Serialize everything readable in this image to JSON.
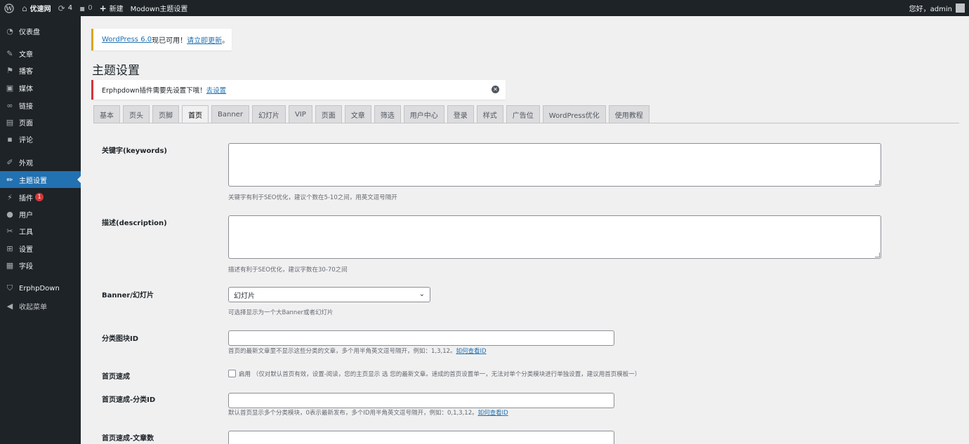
{
  "adminbar": {
    "site_name": "优速网",
    "updates_count": "4",
    "comments_count": "0",
    "new_label": "新建",
    "theme_settings_label": "Modown主题设置",
    "greeting": "您好，admin"
  },
  "sidebar": {
    "items": [
      {
        "label": "仪表盘",
        "icon": "dashboard-icon"
      },
      {
        "label": "文章",
        "icon": "pin-icon"
      },
      {
        "label": "播客",
        "icon": "flag-icon"
      },
      {
        "label": "媒体",
        "icon": "media-icon"
      },
      {
        "label": "链接",
        "icon": "link-icon"
      },
      {
        "label": "页面",
        "icon": "page-icon"
      },
      {
        "label": "评论",
        "icon": "comment-icon"
      },
      {
        "label": "外观",
        "icon": "brush-icon"
      },
      {
        "label": "主题设置",
        "icon": "pen-icon"
      },
      {
        "label": "插件",
        "icon": "plugin-icon",
        "badge": "1"
      },
      {
        "label": "用户",
        "icon": "user-icon"
      },
      {
        "label": "工具",
        "icon": "wrench-icon"
      },
      {
        "label": "设置",
        "icon": "settings-icon"
      },
      {
        "label": "字段",
        "icon": "fields-icon"
      },
      {
        "label": "ErphpDown",
        "icon": "shield-icon"
      },
      {
        "label": "收起菜单",
        "icon": "collapse-icon"
      }
    ]
  },
  "notices": {
    "update_link": "WordPress 6.0",
    "update_text": "现已可用！",
    "update_now": "请立即更新",
    "update_period": "。",
    "erphp_text": "Erphpdown插件需要先设置下哦！",
    "erphp_link": "去设置"
  },
  "page": {
    "title": "主题设置"
  },
  "tabs": [
    "基本",
    "页头",
    "页脚",
    "首页",
    "Banner",
    "幻灯片",
    "VIP",
    "页面",
    "文章",
    "筛选",
    "用户中心",
    "登录",
    "样式",
    "广告位",
    "WordPress优化",
    "使用教程"
  ],
  "active_tab": "首页",
  "form": {
    "keywords_label": "关键字(keywords)",
    "keywords_desc": "关键字有利于SEO优化，建议个数在5-10之间，用英文逗号隔开",
    "description_label": "描述(description)",
    "description_desc": "描述有利于SEO优化，建议字数在30-70之间",
    "banner_label": "Banner/幻灯片",
    "banner_value": "幻灯片",
    "banner_desc": "可选择显示为一个大Banner或者幻灯片",
    "catblock_label": "分类图块ID",
    "catblock_desc": "首页的最新文章里不显示这些分类的文章，多个用半角英文逗号隔开，例如：1,3,12。",
    "catblock_link": "如何查看ID",
    "quick_label": "首页速成",
    "quick_enable": "启用",
    "quick_note": "（仅对默认首页有效，设置-阅读，您的主页显示 选 您的最新文章。速成的首页设置单一，无法对单个分类模块进行单独设置，建议用首页模板一）",
    "quick_cat_label": "首页速成-分类ID",
    "quick_cat_desc": "默认首页显示多个分类模块，0表示最新发布，多个ID用半角英文逗号隔开，例如：0,1,3,12。",
    "quick_cat_link": "如何查看ID",
    "quick_num_label": "首页速成-文章数"
  }
}
